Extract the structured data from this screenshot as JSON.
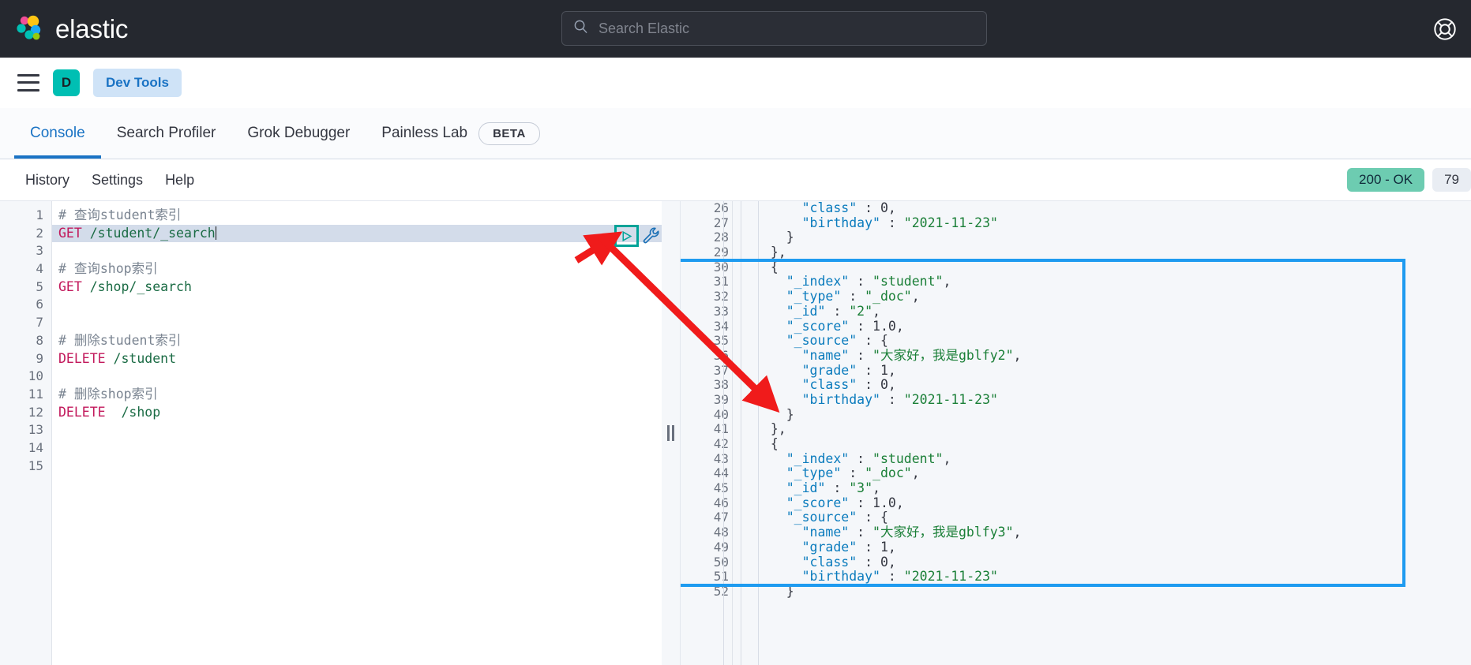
{
  "header": {
    "brand": "elastic",
    "logo_icon": "elastic-logo-icon",
    "search": {
      "placeholder": "Search Elastic",
      "value": "",
      "icon": "search-icon"
    },
    "help_icon": "lifebuoy-help-icon"
  },
  "navbar": {
    "menu_icon": "hamburger-menu-icon",
    "space_avatar": "D",
    "breadcrumb": "Dev Tools"
  },
  "tabs": [
    {
      "label": "Console",
      "active": true,
      "badge": ""
    },
    {
      "label": "Search Profiler",
      "active": false,
      "badge": ""
    },
    {
      "label": "Grok Debugger",
      "active": false,
      "badge": ""
    },
    {
      "label": "Painless Lab",
      "active": false,
      "badge": "BETA"
    }
  ],
  "toolbar": {
    "links": [
      "History",
      "Settings",
      "Help"
    ],
    "status": "200 - OK",
    "time": "79"
  },
  "editor": {
    "active_line": 2,
    "cursor_line": 2,
    "run_icon": "play-run-icon",
    "wrench_icon": "wrench-icon",
    "lines": [
      {
        "n": 1,
        "tokens": [
          {
            "t": "comment",
            "v": "# 查询student索引"
          }
        ]
      },
      {
        "n": 2,
        "tokens": [
          {
            "t": "method",
            "v": "GET"
          },
          {
            "t": "plain",
            "v": " "
          },
          {
            "t": "path",
            "v": "/student/_search"
          }
        ],
        "caret": true
      },
      {
        "n": 3,
        "tokens": []
      },
      {
        "n": 4,
        "tokens": [
          {
            "t": "comment",
            "v": "# 查询shop索引"
          }
        ]
      },
      {
        "n": 5,
        "tokens": [
          {
            "t": "method",
            "v": "GET"
          },
          {
            "t": "plain",
            "v": " "
          },
          {
            "t": "path",
            "v": "/shop/_search"
          }
        ]
      },
      {
        "n": 6,
        "tokens": []
      },
      {
        "n": 7,
        "tokens": []
      },
      {
        "n": 8,
        "tokens": [
          {
            "t": "comment",
            "v": "# 删除student索引"
          }
        ]
      },
      {
        "n": 9,
        "tokens": [
          {
            "t": "method",
            "v": "DELETE"
          },
          {
            "t": "plain",
            "v": " "
          },
          {
            "t": "path",
            "v": "/student"
          }
        ]
      },
      {
        "n": 10,
        "tokens": []
      },
      {
        "n": 11,
        "tokens": [
          {
            "t": "comment",
            "v": "# 删除shop索引"
          }
        ]
      },
      {
        "n": 12,
        "tokens": [
          {
            "t": "method",
            "v": "DELETE"
          },
          {
            "t": "plain",
            "v": "  "
          },
          {
            "t": "path",
            "v": "/shop"
          }
        ]
      },
      {
        "n": 13,
        "tokens": []
      },
      {
        "n": 14,
        "tokens": []
      },
      {
        "n": 15,
        "tokens": []
      }
    ]
  },
  "splitter": {
    "icon": "drag-handle-icon"
  },
  "response": {
    "highlighted_from_line": 30,
    "highlighted_to_line": 51,
    "lines": [
      {
        "n": 26,
        "fold": "",
        "text": "      \"class\" : 0,"
      },
      {
        "n": 27,
        "fold": "",
        "text": "      \"birthday\" : \"2021-11-23\""
      },
      {
        "n": 28,
        "fold": "▲",
        "text": "    }"
      },
      {
        "n": 29,
        "fold": "▲",
        "text": "  },"
      },
      {
        "n": 30,
        "fold": "▼",
        "text": "  {"
      },
      {
        "n": 31,
        "fold": "",
        "text": "    \"_index\" : \"student\","
      },
      {
        "n": 32,
        "fold": "",
        "text": "    \"_type\" : \"_doc\","
      },
      {
        "n": 33,
        "fold": "",
        "text": "    \"_id\" : \"2\","
      },
      {
        "n": 34,
        "fold": "",
        "text": "    \"_score\" : 1.0,"
      },
      {
        "n": 35,
        "fold": "▼",
        "text": "    \"_source\" : {"
      },
      {
        "n": 36,
        "fold": "",
        "text": "      \"name\" : \"大家好，我是gblfy2\","
      },
      {
        "n": 37,
        "fold": "",
        "text": "      \"grade\" : 1,"
      },
      {
        "n": 38,
        "fold": "",
        "text": "      \"class\" : 0,"
      },
      {
        "n": 39,
        "fold": "",
        "text": "      \"birthday\" : \"2021-11-23\""
      },
      {
        "n": 40,
        "fold": "▲",
        "text": "    }"
      },
      {
        "n": 41,
        "fold": "▲",
        "text": "  },"
      },
      {
        "n": 42,
        "fold": "▼",
        "text": "  {"
      },
      {
        "n": 43,
        "fold": "",
        "text": "    \"_index\" : \"student\","
      },
      {
        "n": 44,
        "fold": "",
        "text": "    \"_type\" : \"_doc\","
      },
      {
        "n": 45,
        "fold": "",
        "text": "    \"_id\" : \"3\","
      },
      {
        "n": 46,
        "fold": "",
        "text": "    \"_score\" : 1.0,"
      },
      {
        "n": 47,
        "fold": "▼",
        "text": "    \"_source\" : {"
      },
      {
        "n": 48,
        "fold": "",
        "text": "      \"name\" : \"大家好，我是gblfy3\","
      },
      {
        "n": 49,
        "fold": "",
        "text": "      \"grade\" : 1,"
      },
      {
        "n": 50,
        "fold": "",
        "text": "      \"class\" : 0,"
      },
      {
        "n": 51,
        "fold": "",
        "text": "      \"birthday\" : \"2021-11-23\""
      },
      {
        "n": 52,
        "fold": "▲",
        "text": "    }"
      }
    ]
  },
  "annotations": {
    "arrow_color": "#f01b1b",
    "run_highlight_color": "#00a398",
    "result_highlight_color": "#1e9bf0"
  }
}
